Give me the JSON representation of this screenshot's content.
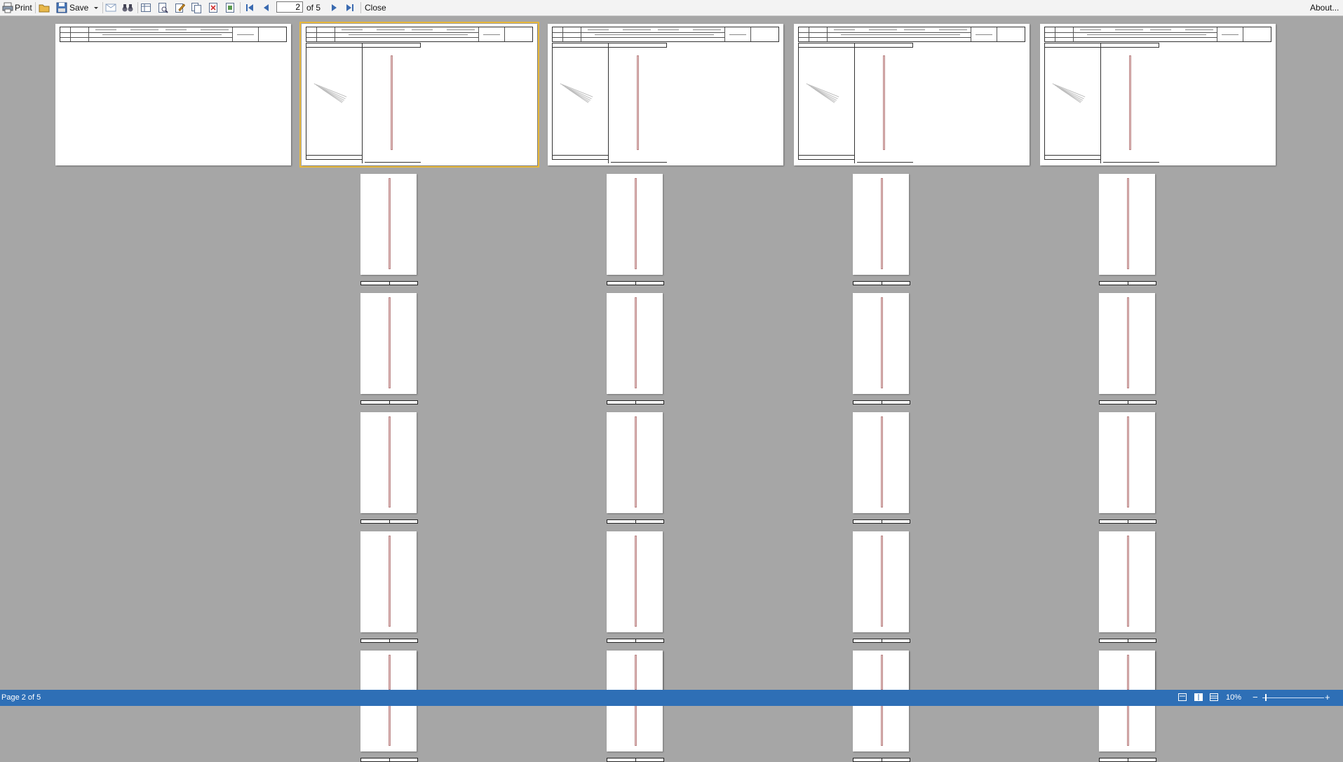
{
  "toolbar": {
    "print_label": "Print",
    "save_label": "Save",
    "current_page": "2",
    "of_label": "of 5",
    "close_label": "Close",
    "about_label": "About..."
  },
  "statusbar": {
    "page_status": "Page 2 of 5",
    "zoom": "10%",
    "zoom_minus": "−",
    "zoom_plus": "+"
  },
  "document": {
    "page_count": 5,
    "selected_page": 2,
    "strip_rows": 5
  },
  "colors": {
    "background": "#a6a6a6",
    "statusbar": "#2e6fb6",
    "selection": "#e8b83a"
  }
}
